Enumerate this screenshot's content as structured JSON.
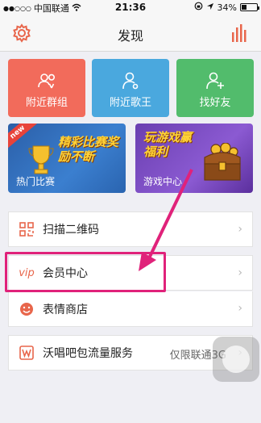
{
  "status_bar": {
    "signal": "●●○○○",
    "carrier": "中国联通",
    "wifi": "wifi-icon",
    "time": "21:36",
    "battery_percent": "34%",
    "battery_level": 0.34
  },
  "nav": {
    "title": "发现",
    "left_icon": "gear-icon",
    "right_icon": "bar-chart-icon",
    "accent": "#e8664b"
  },
  "tiles": [
    {
      "label": "附近群组",
      "icon": "group-location-icon",
      "color": "#f26b5b"
    },
    {
      "label": "附近歌王",
      "icon": "user-location-icon",
      "color": "#4aa8de"
    },
    {
      "label": "找好友",
      "icon": "add-friend-icon",
      "color": "#52bc6c"
    }
  ],
  "banners": [
    {
      "caption": "热门比赛",
      "slogan": "精彩比赛奖励不断",
      "badge": "new"
    },
    {
      "caption": "游戏中心",
      "slogan": "玩游戏赢福利"
    }
  ],
  "list": [
    {
      "label": "扫描二维码",
      "icon": "qr-code-icon"
    },
    {
      "label": "会员中心",
      "icon": "vip-icon",
      "icon_text": "vip"
    },
    {
      "label": "表情商店",
      "icon": "emoji-icon"
    },
    {
      "label": "沃唱吧包流量服务",
      "icon": "unicom-icon",
      "value": "仅限联通3G"
    }
  ],
  "annotation": {
    "highlight_color": "#e0227a"
  }
}
